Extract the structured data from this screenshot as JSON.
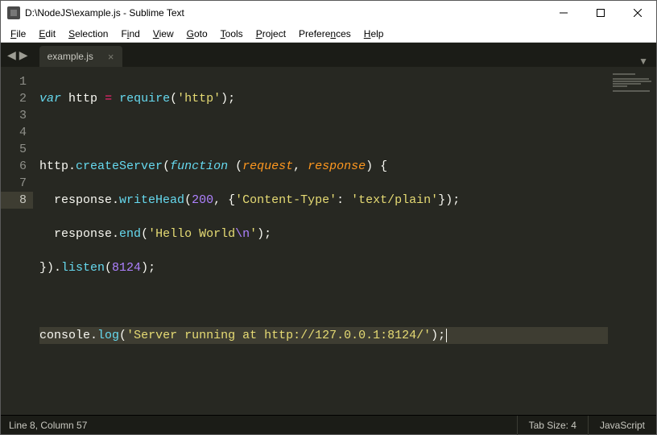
{
  "window": {
    "title": "D:\\NodeJS\\example.js - Sublime Text"
  },
  "menus": [
    {
      "label": "File",
      "accel": "F"
    },
    {
      "label": "Edit",
      "accel": "E"
    },
    {
      "label": "Selection",
      "accel": "S"
    },
    {
      "label": "Find",
      "accel": "i"
    },
    {
      "label": "View",
      "accel": "V"
    },
    {
      "label": "Goto",
      "accel": "G"
    },
    {
      "label": "Tools",
      "accel": "T"
    },
    {
      "label": "Project",
      "accel": "P"
    },
    {
      "label": "Preferences",
      "accel": "n"
    },
    {
      "label": "Help",
      "accel": "H"
    }
  ],
  "tab": {
    "name": "example.js"
  },
  "code": {
    "lines": [
      {
        "n": "1"
      },
      {
        "n": "2"
      },
      {
        "n": "3"
      },
      {
        "n": "4"
      },
      {
        "n": "5"
      },
      {
        "n": "6"
      },
      {
        "n": "7"
      },
      {
        "n": "8"
      }
    ],
    "tok": {
      "var": "var",
      "http_id": "http",
      "eq": "=",
      "require": "require",
      "str_http": "'http'",
      "createServer": "createServer",
      "function": "function",
      "p_request": "request",
      "p_response": "response",
      "response": "response",
      "writeHead": "writeHead",
      "num200": "200",
      "str_ct": "'Content-Type'",
      "str_tp": "'text/plain'",
      "end": "end",
      "str_hello_a": "'Hello World",
      "esc_n": "\\n",
      "str_hello_b": "'",
      "listen": "listen",
      "num8124": "8124",
      "console": "console",
      "log": "log",
      "str_running": "'Server running at http://127.0.0.1:8124/'"
    }
  },
  "status": {
    "position": "Line 8, Column 57",
    "tab_size": "Tab Size: 4",
    "syntax": "JavaScript"
  }
}
